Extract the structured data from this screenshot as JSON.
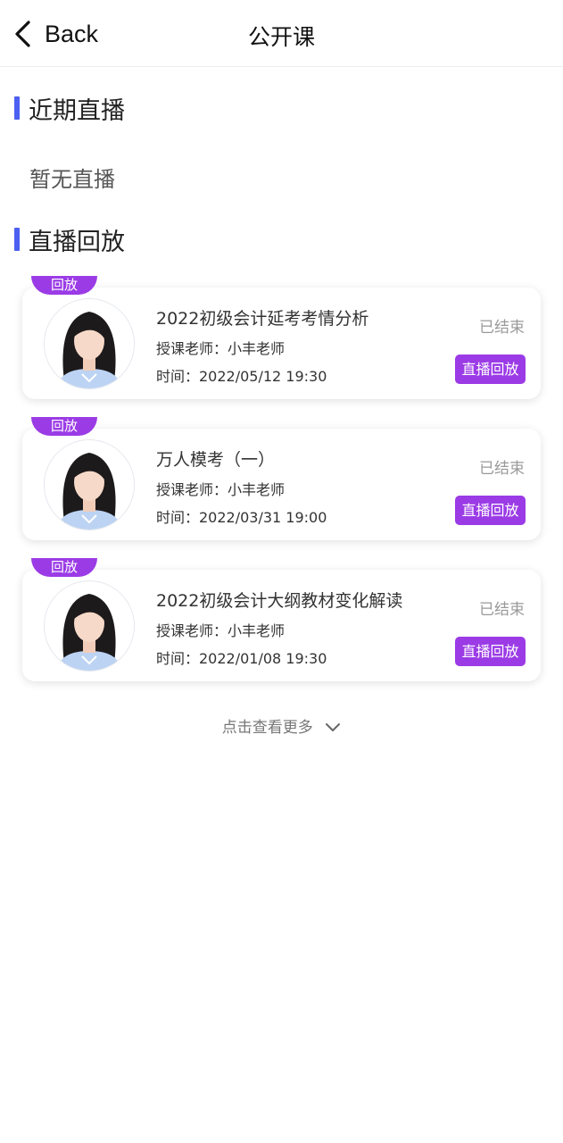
{
  "header": {
    "back_label": "Back",
    "title": "公开课"
  },
  "sections": {
    "live": {
      "title": "近期直播",
      "empty_text": "暂无直播"
    },
    "replay": {
      "title": "直播回放"
    }
  },
  "replays": [
    {
      "tag": "回放",
      "title": "2022初级会计延考考情分析",
      "teacher": "授课老师：小丰老师",
      "time": "时间：2022/05/12 19:30",
      "status": "已结束",
      "button": "直播回放"
    },
    {
      "tag": "回放",
      "title": "万人模考（一）",
      "teacher": "授课老师：小丰老师",
      "time": "时间：2022/03/31 19:00",
      "status": "已结束",
      "button": "直播回放"
    },
    {
      "tag": "回放",
      "title": "2022初级会计大纲教材变化解读",
      "teacher": "授课老师：小丰老师",
      "time": "时间：2022/01/08 19:30",
      "status": "已结束",
      "button": "直播回放"
    }
  ],
  "more_label": "点击查看更多",
  "colors": {
    "accent_blue": "#4b5ff0",
    "accent_purple": "#9b3be6"
  }
}
